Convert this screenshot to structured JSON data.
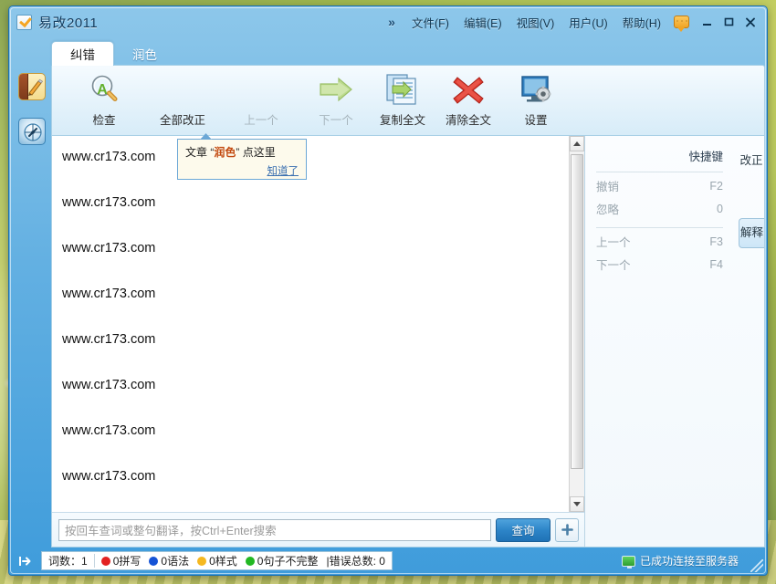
{
  "window": {
    "title": "易改2011",
    "app_icon": "checkbox-check-icon",
    "chevrons": "»",
    "menus": [
      {
        "label": "文件(F)",
        "name": "menu-file"
      },
      {
        "label": "编辑(E)",
        "name": "menu-edit"
      },
      {
        "label": "视图(V)",
        "name": "menu-view"
      },
      {
        "label": "用户(U)",
        "name": "menu-user"
      },
      {
        "label": "帮助(H)",
        "name": "menu-help"
      }
    ],
    "message_icon": "message-bubble-icon",
    "minimize": "minimize-icon",
    "maximize": "maximize-icon",
    "close": "close-icon"
  },
  "tabs": [
    {
      "label": "纠错",
      "active": true
    },
    {
      "label": "润色",
      "active": false
    }
  ],
  "left_rail": [
    {
      "name": "notebook-pencil-icon",
      "label": "notebook"
    },
    {
      "name": "compass-icon",
      "label": "compass"
    }
  ],
  "toolbar": {
    "buttons": [
      {
        "label": "检查",
        "icon": "magnifier-a-icon",
        "disabled": false
      },
      {
        "label": "全部改正",
        "icon": "fix-all-icon",
        "disabled": false
      },
      {
        "label": "上一个",
        "icon": "arrow-up-icon",
        "disabled": true
      },
      {
        "label": "下一个",
        "icon": "arrow-right-icon",
        "disabled": false
      },
      {
        "label": "复制全文",
        "icon": "copy-document-icon",
        "disabled": false
      },
      {
        "label": "清除全文",
        "icon": "red-cross-icon",
        "disabled": false
      },
      {
        "label": "设置",
        "icon": "monitor-gear-icon",
        "disabled": false
      }
    ]
  },
  "callout": {
    "prefix": "文章 “",
    "highlight": "润色",
    "suffix": "” 点这里",
    "link": "知道了"
  },
  "editor": {
    "lines": [
      "www.cr173.com",
      "www.cr173.com",
      "www.cr173.com",
      "www.cr173.com",
      "www.cr173.com",
      "www.cr173.com",
      "www.cr173.com",
      "www.cr173.com"
    ]
  },
  "search": {
    "placeholder": "按回车查词或整句翻译，按Ctrl+Enter搜索",
    "value": "",
    "button_label": "查询",
    "add_icon": "plus-icon"
  },
  "right_panel": {
    "title": "快捷键",
    "rows_group1": [
      {
        "label": "撤销",
        "key": "F2"
      },
      {
        "label": "忽略",
        "key": "0"
      }
    ],
    "rows_group2": [
      {
        "label": "上一个",
        "key": "F3"
      },
      {
        "label": "下一个",
        "key": "F4"
      }
    ],
    "vtabs": [
      {
        "label": "改正",
        "active": false
      },
      {
        "label": "解释",
        "active": true
      }
    ]
  },
  "statusbar": {
    "expand_icon": "expand-panel-icon",
    "word_count_label": "词数：",
    "word_count_value": "1",
    "stats": [
      {
        "color": "#e32222",
        "text": "0拼写"
      },
      {
        "color": "#1553d6",
        "text": "0语法"
      },
      {
        "color": "#f5b820",
        "text": "0样式"
      },
      {
        "color": "#22b822",
        "text": "0句子不完整"
      }
    ],
    "total_label": "|错误总数: 0",
    "connection_icon": "monitor-icon",
    "connection_text": "已成功连接至服务器"
  },
  "colors": {
    "accent": "#2d85c8",
    "titlebar": "#63b0e2",
    "window_border": "#1a6fb5"
  }
}
